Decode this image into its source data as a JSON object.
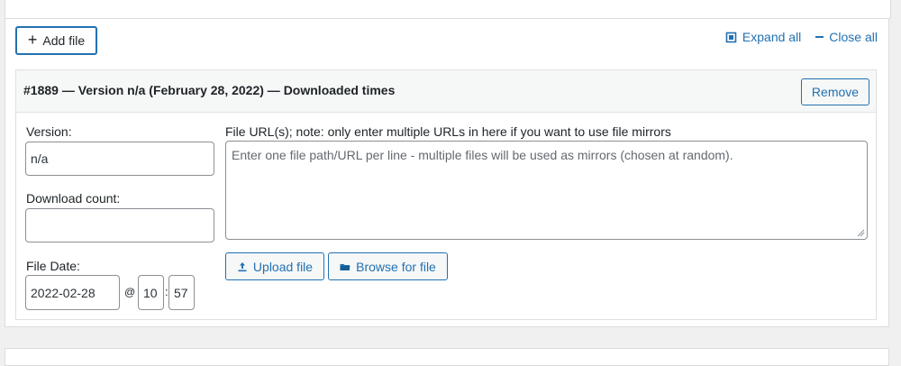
{
  "toolbar": {
    "add_file_label": "Add file",
    "expand_all_label": "Expand all",
    "close_all_label": "Close all"
  },
  "file": {
    "title": "#1889 — Version n/a (February 28, 2022) — Downloaded times",
    "remove_label": "Remove",
    "version_label": "Version:",
    "version_value": "n/a",
    "download_count_label": "Download count:",
    "download_count_value": "",
    "file_date_label": "File Date:",
    "date_value": "2022-02-28",
    "at_symbol": "@",
    "hour_value": "10",
    "colon": ":",
    "minute_value": "57",
    "urls_label": "File URL(s); note: only enter multiple URLs in here if you want to use file mirrors",
    "urls_placeholder": "Enter one file path/URL per line - multiple files will be used as mirrors (chosen at random).",
    "upload_label": "Upload file",
    "browse_label": "Browse for file"
  },
  "icons": {
    "plus": "plus-icon",
    "expand": "expand-icon",
    "collapse": "minus-icon",
    "upload": "upload-icon",
    "folder": "folder-icon"
  },
  "colors": {
    "accent": "#2271b1",
    "background": "#f0f0f1",
    "border": "#8c8f94"
  }
}
